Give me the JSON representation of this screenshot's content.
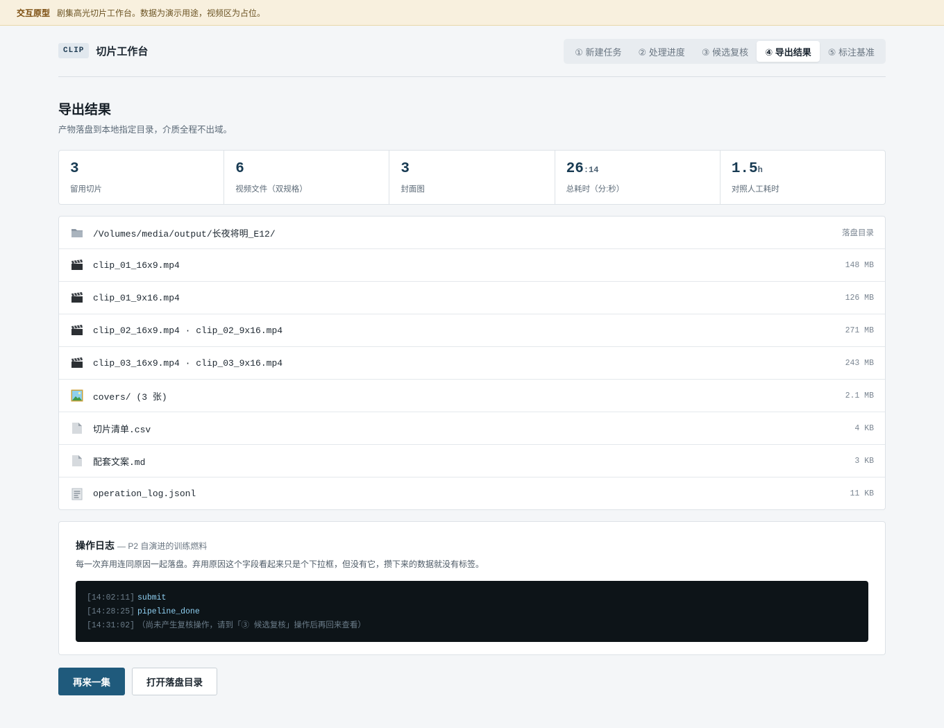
{
  "banner": {
    "tag": "交互原型",
    "text": "剧集高光切片工作台。数据为演示用途，视频区为占位。"
  },
  "brand": {
    "badge": "CLIP",
    "title": "切片工作台"
  },
  "tabs": [
    {
      "label": "① 新建任务",
      "active": false
    },
    {
      "label": "② 处理进度",
      "active": false
    },
    {
      "label": "③ 候选复核",
      "active": false
    },
    {
      "label": "④ 导出结果",
      "active": true
    },
    {
      "label": "⑤ 标注基准",
      "active": false
    }
  ],
  "section": {
    "title": "导出结果",
    "subtitle": "产物落盘到本地指定目录，介质全程不出域。"
  },
  "stats": [
    {
      "value": "3",
      "unit": "",
      "label": "留用切片"
    },
    {
      "value": "6",
      "unit": "",
      "label": "视频文件（双规格）"
    },
    {
      "value": "3",
      "unit": "",
      "label": "封面图"
    },
    {
      "value": "26",
      "unit": ":14",
      "label": "总耗时（分:秒）"
    },
    {
      "value": "1.5",
      "unit": "h",
      "label": "对照人工耗时"
    }
  ],
  "files": [
    {
      "icon": "folder-icon",
      "name": "/Volumes/media/output/长夜将明_E12/",
      "meta": "落盘目录"
    },
    {
      "icon": "clapper-icon",
      "name": "clip_01_16x9.mp4",
      "meta": "148 MB"
    },
    {
      "icon": "clapper-icon",
      "name": "clip_01_9x16.mp4",
      "meta": "126 MB"
    },
    {
      "icon": "clapper-icon",
      "name": "clip_02_16x9.mp4 · clip_02_9x16.mp4",
      "meta": "271 MB"
    },
    {
      "icon": "clapper-icon",
      "name": "clip_03_16x9.mp4 · clip_03_9x16.mp4",
      "meta": "243 MB"
    },
    {
      "icon": "image-icon",
      "name": "covers/ (3 张)",
      "meta": "2.1 MB"
    },
    {
      "icon": "document-icon",
      "name": "切片清单.csv",
      "meta": "4 KB"
    },
    {
      "icon": "document-icon",
      "name": "配套文案.md",
      "meta": "3 KB"
    },
    {
      "icon": "log-file-icon",
      "name": "operation_log.jsonl",
      "meta": "11 KB"
    }
  ],
  "log": {
    "title": "操作日志",
    "subtitle": "— P2 自演进的训练燃料",
    "description": "每一次弃用连同原因一起落盘。弃用原因这个字段看起来只是个下拉框，但没有它，攒下来的数据就没有标签。",
    "entries": [
      {
        "time": "[14:02:11]",
        "event": "submit",
        "note": ""
      },
      {
        "time": "[14:28:25]",
        "event": "pipeline_done",
        "note": ""
      },
      {
        "time": "[14:31:02]",
        "event": "",
        "note": "（尚未产生复核操作，请到「③ 候选复核」操作后再回来查看）"
      }
    ]
  },
  "actions": {
    "primary": "再来一集",
    "secondary": "打开落盘目录"
  },
  "colors": {
    "accent": "#1f5a7c",
    "banner_bg": "#f8f0de",
    "terminal_bg": "#0d1418"
  }
}
